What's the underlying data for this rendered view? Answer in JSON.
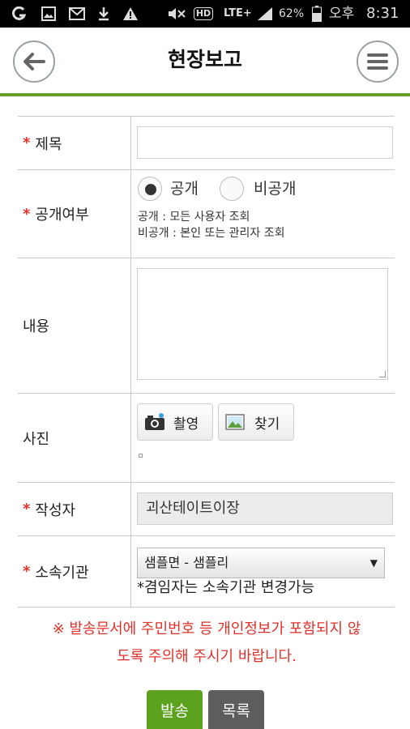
{
  "statusbar": {
    "battery": "62%",
    "ampm": "오후",
    "time": "8:31",
    "network": "LTE+",
    "hd": "HD",
    "icons": [
      "g-icon",
      "image-icon",
      "mail-icon",
      "download-icon",
      "warning-icon",
      "mute-icon",
      "hd-icon",
      "lte-icon",
      "signal-icon",
      "battery-icon"
    ]
  },
  "header": {
    "title": "현장보고",
    "back_icon": "back-arrow-icon",
    "menu_icon": "hamburger-menu-icon",
    "accent": "#6a9e2c"
  },
  "form": {
    "title_label": "제목",
    "title_value": "",
    "public_label": "공개여부",
    "public_option": "공개",
    "private_option": "비공개",
    "selected": "공개",
    "hint_public": "공개 : 모든 사용자 조회",
    "hint_private": "비공개 : 본인 또는 관리자 조회",
    "content_label": "내용",
    "content_value": "",
    "photo_label": "사진",
    "camera_button": "촬영",
    "find_button": "찾기",
    "author_label": "작성자",
    "author_value": "괴산테이트이장",
    "org_label": "소속기관",
    "org_selected": "샘플면 - 샘플리",
    "org_note": "*겸임자는 소속기관 변경가능",
    "required_mark": "*"
  },
  "notice": {
    "line1": "※ 발송문서에 주민번호 등 개인정보가 포함되지 않",
    "line2": "도록 주의해 주시기 바랍니다."
  },
  "actions": {
    "send_label": "발송",
    "list_label": "목록",
    "send_color": "#5da21f",
    "list_color": "#5d5d5d"
  }
}
